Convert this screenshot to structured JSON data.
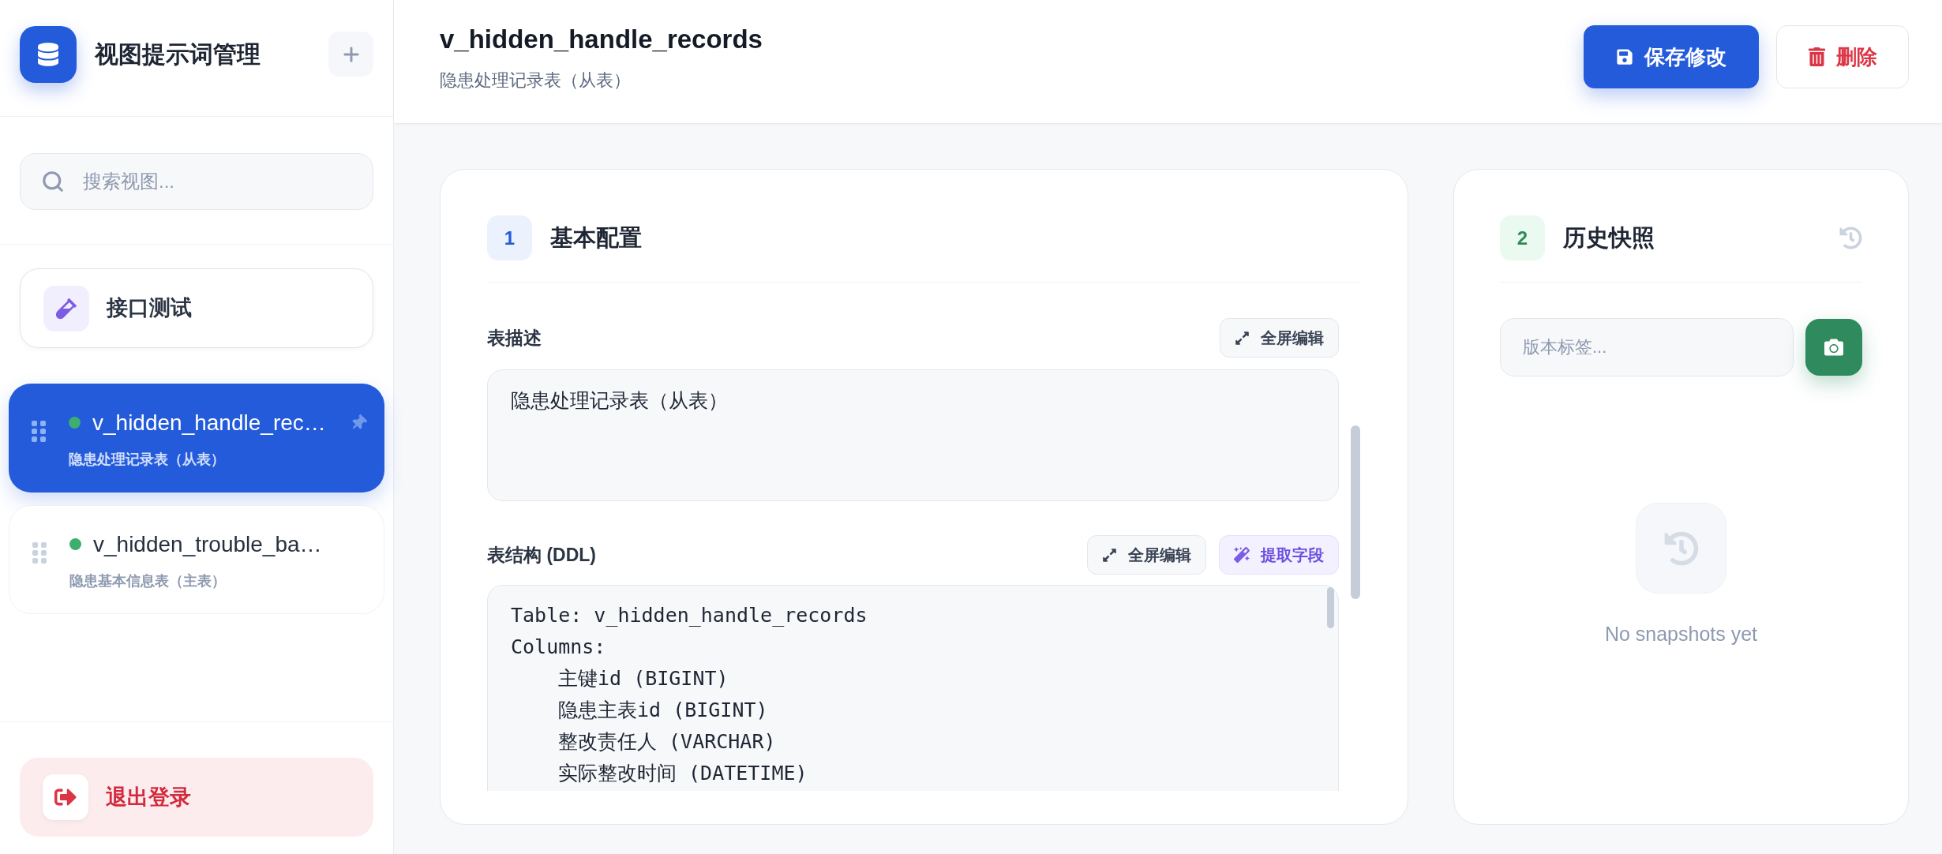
{
  "sidebar": {
    "title": "视图提示词管理",
    "search": {
      "placeholder": "搜索视图..."
    },
    "tools": [
      {
        "label": "接口测试"
      }
    ],
    "views": [
      {
        "name": "v_hidden_handle_rec…",
        "description": "隐患处理记录表（从表）",
        "selected": true,
        "pinned": true,
        "color": "#3dae6f"
      },
      {
        "name": "v_hidden_trouble_ba…",
        "description": "隐患基本信息表（主表）",
        "selected": false,
        "pinned": false,
        "color": "#3dae6f"
      }
    ],
    "logout": {
      "label": "退出登录"
    }
  },
  "header": {
    "title": "v_hidden_handle_records",
    "subtitle": "隐患处理记录表（从表）",
    "actions": [
      {
        "label": "保存修改",
        "kind": "primary"
      },
      {
        "label": "删除",
        "kind": "danger"
      }
    ]
  },
  "config_panel": {
    "number": "1",
    "title": "基本配置",
    "fields": [
      {
        "kind": "text",
        "label": "表描述",
        "value": "隐患处理记录表（从表）",
        "actions": [
          {
            "label": "全屏编辑",
            "kind": "expand"
          }
        ]
      },
      {
        "kind": "code",
        "label": "表结构 (DDL)",
        "lines": [
          {
            "text": "Table: v_hidden_handle_records"
          },
          {
            "text": "Columns:",
            "children": [
              {
                "text": "主键id (BIGINT)"
              },
              {
                "text": "隐患主表id (BIGINT)"
              },
              {
                "text": "整改责任人 (VARCHAR)"
              },
              {
                "text": "实际整改时间 (DATETIME)"
              }
            ]
          }
        ],
        "actions": [
          {
            "label": "全屏编辑",
            "kind": "expand"
          },
          {
            "label": "提取字段",
            "kind": "extract"
          }
        ]
      }
    ]
  },
  "history_panel": {
    "number": "2",
    "title": "历史快照",
    "label_input": {
      "placeholder": "版本标签..."
    },
    "empty_text": "No snapshots yet"
  }
}
